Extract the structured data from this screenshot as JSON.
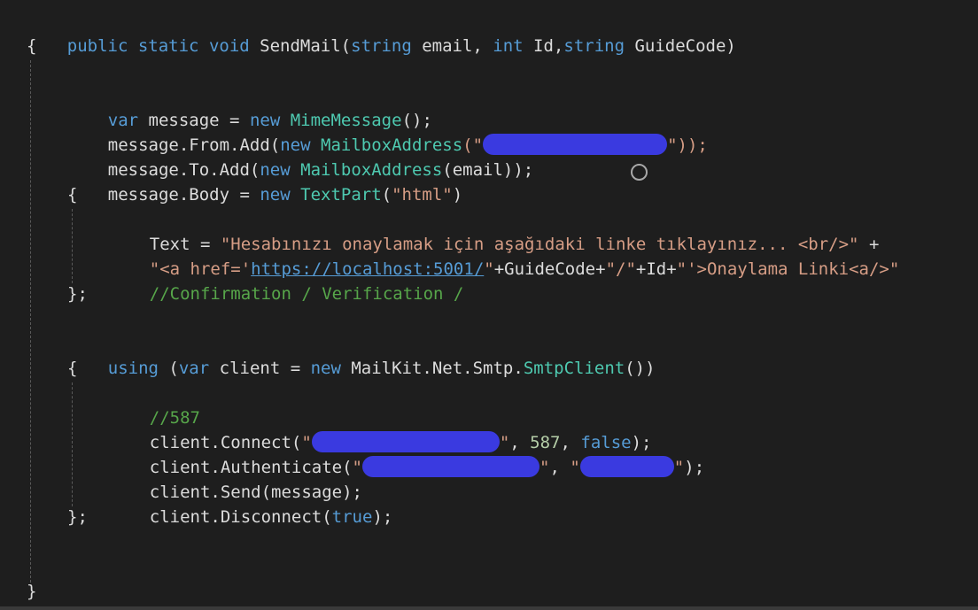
{
  "code": {
    "l1_kw1": "public",
    "l1_kw2": "static",
    "l1_kw3": "void",
    "l1_name": "SendMail(",
    "l1_t1": "string",
    "l1_p1": " email, ",
    "l1_t2": "int",
    "l1_p2": " Id,",
    "l1_t3": "string",
    "l1_p3": " GuideCode)",
    "brace_open": "{",
    "brace_close": "}",
    "l3_var": "var",
    "l3_a": " message = ",
    "l3_new": "new",
    "l3_type": "MimeMessage",
    "l3_end": "();",
    "l4_a": "message.From.Add(",
    "l4_new": "new",
    "l4_type": "MailboxAddress",
    "l4_open": "(\"",
    "l4_end": "\"));",
    "l5_a": "message.To.Add(",
    "l5_new": "new",
    "l5_type": "MailboxAddress",
    "l5_end": "(email));",
    "l6_a": "message.Body = ",
    "l6_new": "new",
    "l6_type": "TextPart",
    "l6_p": "(",
    "l6_str": "\"html\"",
    "l6_end": ")",
    "l8_a": "Text = ",
    "l8_str": "\"Hesabınızı onaylamak için aşağıdaki linke tıklayınız... <br/>\"",
    "l8_end": " +",
    "l9_str1": "\"<a href='",
    "l9_link": "https://localhost:5001/",
    "l9_str2": "\"",
    "l9_p1": "+GuideCode+",
    "l9_str3": "\"/\"",
    "l9_p2": "+Id+",
    "l9_str4": "\"'>Onaylama Linki<a/>\"",
    "l10_cmt": "//Confirmation / Verification /",
    "close_semi": "};",
    "l13_using": "using",
    "l13_a": " (",
    "l13_var": "var",
    "l13_b": " client = ",
    "l13_new": "new",
    "l13_c": " MailKit.Net.Smtp.",
    "l13_type": "SmtpClient",
    "l13_end": "())",
    "l15_cmt": "//587",
    "l16_a": "client.Connect(",
    "l16_q": "\"",
    "l16_q2": "\"",
    "l16_b": ", ",
    "l16_num": "587",
    "l16_c": ", ",
    "l16_false": "false",
    "l16_end": ");",
    "l17_a": "client.Authenticate(",
    "l17_q1": "\"",
    "l17_q2": "\"",
    "l17_b": ", ",
    "l17_q3": "\"",
    "l17_q4": "\"",
    "l17_end": ");",
    "l18": "client.Send(message);",
    "l19_a": "client.Disconnect(",
    "l19_true": "true",
    "l19_end": ");"
  },
  "colors": {
    "background": "#1e1e1e",
    "keyword": "#569cd6",
    "type": "#4ec9b0",
    "string": "#d69d85",
    "comment": "#57a64a",
    "redaction": "#3a3ae0"
  }
}
